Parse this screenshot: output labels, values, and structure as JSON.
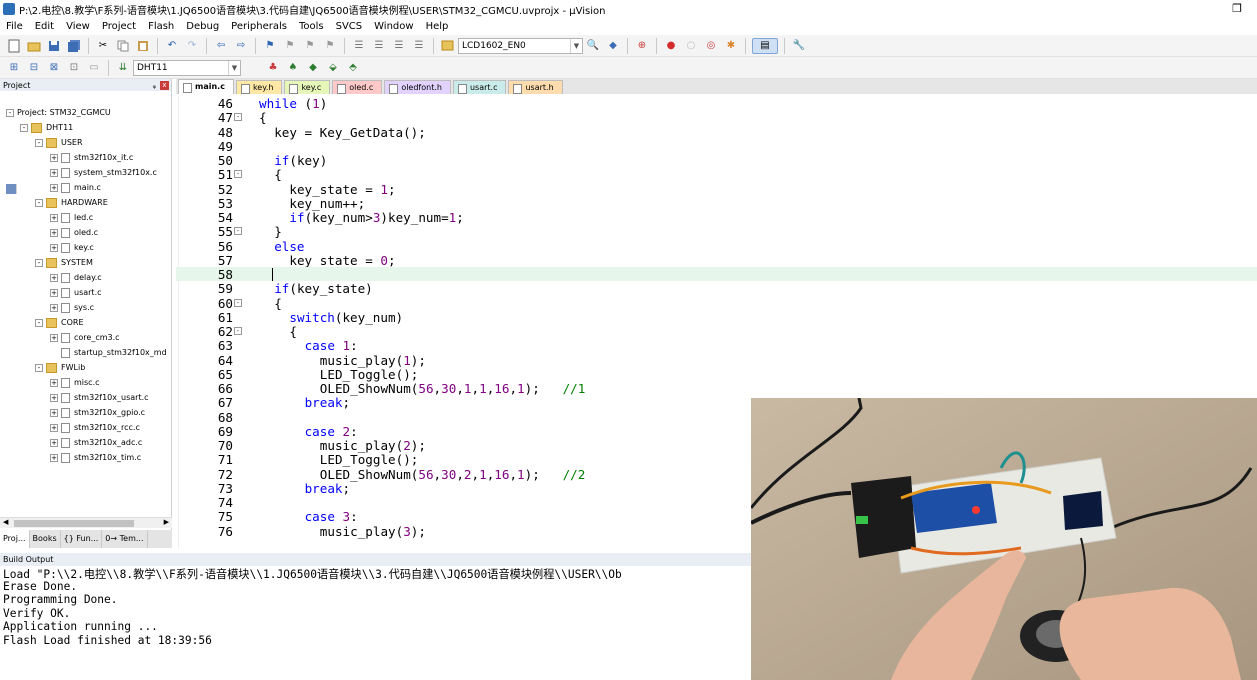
{
  "window": {
    "title": "P:\\2.电控\\8.教学\\F系列-语音模块\\1.JQ6500语音模块\\3.代码自建\\JQ6500语音模块例程\\USER\\STM32_CGMCU.uvprojx - µVision",
    "restore_glyph": "❐"
  },
  "menu": [
    "File",
    "Edit",
    "View",
    "Project",
    "Flash",
    "Debug",
    "Peripherals",
    "Tools",
    "SVCS",
    "Window",
    "Help"
  ],
  "toolbar": {
    "device_select": "LCD1602_EN0",
    "target_select": "DHT11"
  },
  "project_panel": {
    "title": "Project",
    "pin_glyph": "ᵩ",
    "close_glyph": "x",
    "tree": [
      {
        "label": "Project: STM32_CGMCU",
        "level": 0,
        "kind": "proj",
        "expander": "-"
      },
      {
        "label": "DHT11",
        "level": 1,
        "kind": "folder",
        "expander": "-"
      },
      {
        "label": "USER",
        "level": 2,
        "kind": "folder",
        "expander": "-"
      },
      {
        "label": "stm32f10x_it.c",
        "level": 3,
        "kind": "file",
        "expander": "+"
      },
      {
        "label": "system_stm32f10x.c",
        "level": 3,
        "kind": "file",
        "expander": "+"
      },
      {
        "label": "main.c",
        "level": 3,
        "kind": "file",
        "expander": "+"
      },
      {
        "label": "HARDWARE",
        "level": 2,
        "kind": "folder",
        "expander": "-"
      },
      {
        "label": "led.c",
        "level": 3,
        "kind": "file",
        "expander": "+"
      },
      {
        "label": "oled.c",
        "level": 3,
        "kind": "file",
        "expander": "+"
      },
      {
        "label": "key.c",
        "level": 3,
        "kind": "file",
        "expander": "+"
      },
      {
        "label": "SYSTEM",
        "level": 2,
        "kind": "folder",
        "expander": "-"
      },
      {
        "label": "delay.c",
        "level": 3,
        "kind": "file",
        "expander": "+"
      },
      {
        "label": "usart.c",
        "level": 3,
        "kind": "file",
        "expander": "+"
      },
      {
        "label": "sys.c",
        "level": 3,
        "kind": "file",
        "expander": "+"
      },
      {
        "label": "CORE",
        "level": 2,
        "kind": "folder",
        "expander": "-"
      },
      {
        "label": "core_cm3.c",
        "level": 3,
        "kind": "file",
        "expander": "+"
      },
      {
        "label": "startup_stm32f10x_md",
        "level": 3,
        "kind": "file",
        "expander": ""
      },
      {
        "label": "FWLib",
        "level": 2,
        "kind": "folder",
        "expander": "-"
      },
      {
        "label": "misc.c",
        "level": 3,
        "kind": "file",
        "expander": "+"
      },
      {
        "label": "stm32f10x_usart.c",
        "level": 3,
        "kind": "file",
        "expander": "+"
      },
      {
        "label": "stm32f10x_gpio.c",
        "level": 3,
        "kind": "file",
        "expander": "+"
      },
      {
        "label": "stm32f10x_rcc.c",
        "level": 3,
        "kind": "file",
        "expander": "+"
      },
      {
        "label": "stm32f10x_adc.c",
        "level": 3,
        "kind": "file",
        "expander": "+"
      },
      {
        "label": "stm32f10x_tim.c",
        "level": 3,
        "kind": "file",
        "expander": "+"
      }
    ],
    "tabs": [
      "Proj...",
      "Books",
      "{} Fun...",
      "0→ Tem..."
    ]
  },
  "file_tabs": [
    {
      "label": "main.c",
      "color": "#ffffff",
      "active": true
    },
    {
      "label": "key.h",
      "color": "#ffe7a6",
      "active": false
    },
    {
      "label": "key.c",
      "color": "#e6f5b8",
      "active": false
    },
    {
      "label": "oled.c",
      "color": "#ffc9c9",
      "active": false
    },
    {
      "label": "oledfont.h",
      "color": "#e2d2ff",
      "active": false
    },
    {
      "label": "usart.c",
      "color": "#c9ecea",
      "active": false
    },
    {
      "label": "usart.h",
      "color": "#ffdcae",
      "active": false
    }
  ],
  "code": [
    {
      "n": "46",
      "t": "while (1)",
      "indent": 0,
      "fold": ""
    },
    {
      "n": "47",
      "t": "{",
      "indent": 0,
      "fold": "-"
    },
    {
      "n": "48",
      "t": "key = Key_GetData();",
      "indent": 1,
      "fold": ""
    },
    {
      "n": "49",
      "t": "",
      "indent": 1,
      "fold": ""
    },
    {
      "n": "50",
      "t": "if(key)",
      "indent": 1,
      "fold": ""
    },
    {
      "n": "51",
      "t": "{",
      "indent": 1,
      "fold": "-"
    },
    {
      "n": "52",
      "t": "key_state = 1;",
      "indent": 2,
      "fold": ""
    },
    {
      "n": "53",
      "t": "key_num++;",
      "indent": 2,
      "fold": ""
    },
    {
      "n": "54",
      "t": "if(key_num>3)key_num=1;",
      "indent": 2,
      "fold": ""
    },
    {
      "n": "55",
      "t": "}",
      "indent": 1,
      "fold": "-"
    },
    {
      "n": "56",
      "t": "else",
      "indent": 1,
      "fold": ""
    },
    {
      "n": "57",
      "t": "key_state = 0;",
      "indent": 2,
      "fold": ""
    },
    {
      "n": "58",
      "t": "",
      "indent": 1,
      "fold": "",
      "current": true
    },
    {
      "n": "59",
      "t": "if(key_state)",
      "indent": 1,
      "fold": ""
    },
    {
      "n": "60",
      "t": "{",
      "indent": 1,
      "fold": "-"
    },
    {
      "n": "61",
      "t": "switch(key_num)",
      "indent": 2,
      "fold": ""
    },
    {
      "n": "62",
      "t": "{",
      "indent": 2,
      "fold": "-"
    },
    {
      "n": "63",
      "t": "case 1:",
      "indent": 3,
      "fold": ""
    },
    {
      "n": "64",
      "t": "music_play(1);",
      "indent": 4,
      "fold": ""
    },
    {
      "n": "65",
      "t": "LED_Toggle();",
      "indent": 4,
      "fold": ""
    },
    {
      "n": "66",
      "t": "OLED_ShowNum(56,30,1,1,16,1);   //1",
      "indent": 4,
      "fold": ""
    },
    {
      "n": "67",
      "t": "break;",
      "indent": 3,
      "fold": ""
    },
    {
      "n": "68",
      "t": "",
      "indent": 3,
      "fold": ""
    },
    {
      "n": "69",
      "t": "case 2:",
      "indent": 3,
      "fold": ""
    },
    {
      "n": "70",
      "t": "music_play(2);",
      "indent": 4,
      "fold": ""
    },
    {
      "n": "71",
      "t": "LED_Toggle();",
      "indent": 4,
      "fold": ""
    },
    {
      "n": "72",
      "t": "OLED_ShowNum(56,30,2,1,16,1);   //2",
      "indent": 4,
      "fold": ""
    },
    {
      "n": "73",
      "t": "break;",
      "indent": 3,
      "fold": ""
    },
    {
      "n": "74",
      "t": "",
      "indent": 3,
      "fold": ""
    },
    {
      "n": "75",
      "t": "case 3:",
      "indent": 3,
      "fold": ""
    },
    {
      "n": "76",
      "t": "music_play(3);",
      "indent": 4,
      "fold": ""
    }
  ],
  "build_output": {
    "title": "Build Output",
    "lines": [
      "Load \"P:\\\\2.电控\\\\8.教学\\\\F系列-语音模块\\\\1.JQ6500语音模块\\\\3.代码自建\\\\JQ6500语音模块例程\\\\USER\\\\Ob",
      "Erase Done.",
      "Programming Done.",
      "Verify OK.",
      "Application running ...",
      "Flash Load finished at 18:39:56"
    ]
  },
  "colors": {
    "keyword": "#0000ff",
    "number": "#800080",
    "comment": "#008000",
    "current_line": "#e6f6eb"
  }
}
